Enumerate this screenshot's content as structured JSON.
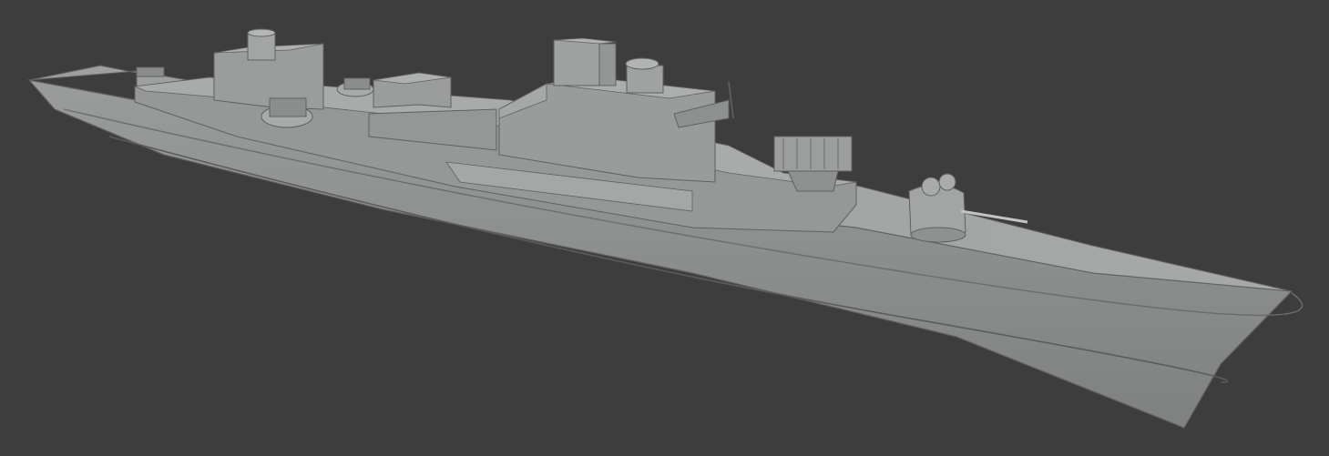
{
  "viewport": {
    "background_color": "#3d3d3d"
  },
  "model": {
    "hull_color": "#8f9190",
    "hull_shadow_color": "#7d7f7e",
    "deck_color": "#a2a4a3",
    "superstructure_color": "#9b9d9c",
    "superstructure_top_color": "#a9abaa",
    "edge_color": "#5f6160"
  }
}
